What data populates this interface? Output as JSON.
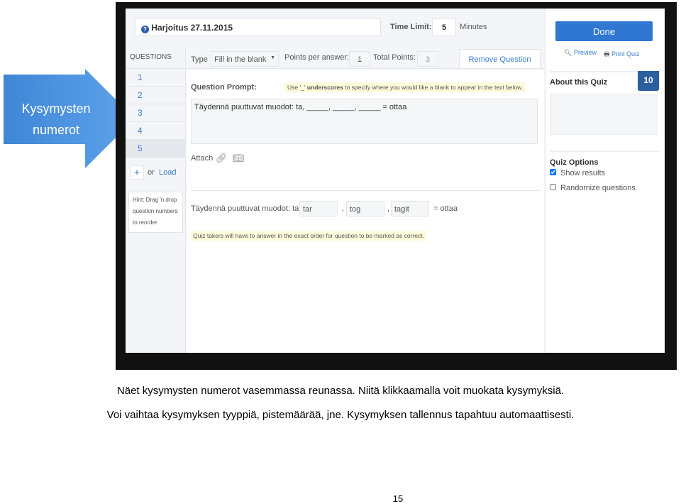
{
  "callout": {
    "text": "Kysymysten numerot",
    "color": "#4a8fd8"
  },
  "quiz": {
    "title": "Harjoitus 27.11.2015",
    "time_limit_label": "Time Limit:",
    "time_limit_value": "5",
    "time_unit": "Minutes"
  },
  "sidebar": {
    "header": "QUESTIONS",
    "items": [
      "1",
      "2",
      "3",
      "4",
      "5"
    ],
    "selected": "5",
    "add_label": "+",
    "or_label": "or",
    "load_label": "Load",
    "hint": "Hint: Drag 'n drop question numbers to reorder"
  },
  "toolbar": {
    "type_label": "Type",
    "type_value": "Fill in the blank",
    "points_label": "Points per answer:",
    "points_value": "1",
    "total_label": "Total Points:",
    "total_value": "3",
    "remove_label": "Remove Question"
  },
  "prompt": {
    "label": "Question Prompt:",
    "hint_pre": "Use '_' ",
    "hint_bold": "underscores",
    "hint_post": " to specify where you would like a blank to appear in the text below.",
    "text": "Täydennä puuttuvat muodot: ta, _____, _____, _____ = ottaa",
    "attach_label": "Attach"
  },
  "preview": {
    "lead": "Täydennä puuttuvat muodot: ta,",
    "blanks": [
      "tar",
      "tog",
      "tagit"
    ],
    "sep": ",",
    "tail": "= ottaa",
    "note": "Quiz takers will have to answer in the exact order for question to be marked as correct."
  },
  "right": {
    "done_label": "Done",
    "preview_label": "Preview",
    "print_label": "Print Quiz",
    "about_label": "About this Quiz",
    "count": "10",
    "options_label": "Quiz Options",
    "options": [
      {
        "label": "Show results",
        "checked": true
      },
      {
        "label": "Randomize questions",
        "checked": false
      }
    ]
  },
  "caption": {
    "line1": "Näet kysymysten numerot vasemmassa reunassa. Niitä klikkaamalla voit muokata kysymyksiä.",
    "line2": "Voi vaihtaa kysymyksen tyyppiä, pistemäärää, jne. Kysymyksen tallennus tapahtuu automaattisesti."
  },
  "page_number": "15"
}
